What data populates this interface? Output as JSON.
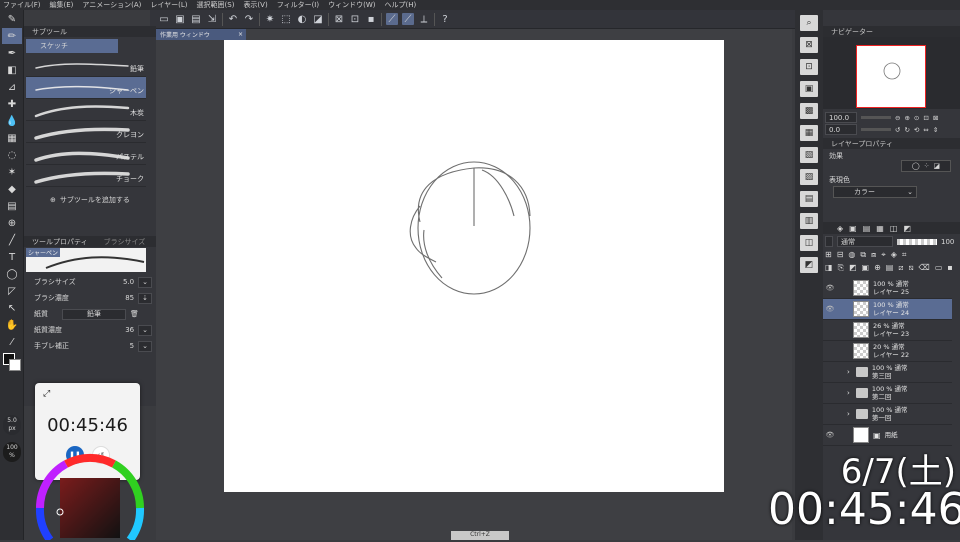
{
  "menu": [
    "ファイル(F)",
    "編集(E)",
    "アニメーション(A)",
    "レイヤー(L)",
    "選択範囲(S)",
    "表示(V)",
    "フィルター(I)",
    "ウィンドウ(W)",
    "ヘルプ(H)"
  ],
  "canvas_tab": {
    "label": "作業用 ウィンドウ"
  },
  "sub_tool": {
    "title": "サブツール",
    "active_group": "スケッチ",
    "brushes": [
      {
        "label": "鉛筆",
        "selected": false
      },
      {
        "label": "シャーペン",
        "selected": true
      },
      {
        "label": "木炭",
        "selected": false
      },
      {
        "label": "クレヨン",
        "selected": false
      },
      {
        "label": "パステル",
        "selected": false
      },
      {
        "label": "チョーク",
        "selected": false
      }
    ],
    "add_label": "サブツールを追加する"
  },
  "tool_property": {
    "title": "ツールプロパティ",
    "tab2": "ブラシサイズ",
    "brush_name": "シャーペン",
    "brush_size_label": "ブラシサイズ",
    "brush_size_value": "5.0",
    "brush_density_label": "ブラシ濃度",
    "brush_density_value": "85",
    "paper_label": "紙質",
    "paper_value": "鉛筆",
    "paper_density_label": "紙質濃度",
    "paper_density_value": "36",
    "stabilizer_label": "手ブレ補正",
    "stabilizer_value": "5"
  },
  "size_indicator": {
    "size": "5.0",
    "unit": "px",
    "opacity": "100",
    "opacity_unit": "%"
  },
  "timer": {
    "time": "00:45:46"
  },
  "navigator": {
    "title": "ナビゲーター",
    "zoom": "100.0",
    "rotation": "0.0"
  },
  "layer_property": {
    "title": "レイヤープロパティ",
    "effect_label": "効果",
    "color_label": "表現色",
    "color_value": "カラー"
  },
  "layer_panel": {
    "blend_mode": "通常",
    "opacity": "100"
  },
  "layers": [
    {
      "line1": "100 % 通常",
      "line2": "レイヤー 25",
      "type": "raster",
      "selected": false,
      "visible": true
    },
    {
      "line1": "100 % 通常",
      "line2": "レイヤー 24",
      "type": "raster",
      "selected": true,
      "visible": true
    },
    {
      "line1": "26 % 通常",
      "line2": "レイヤー 23",
      "type": "raster",
      "selected": false,
      "visible": false
    },
    {
      "line1": "20 % 通常",
      "line2": "レイヤー 22",
      "type": "raster",
      "selected": false,
      "visible": false
    },
    {
      "line1": "100 % 通常",
      "line2": "第三回",
      "type": "folder",
      "selected": false,
      "visible": false
    },
    {
      "line1": "100 % 通常",
      "line2": "第二回",
      "type": "folder",
      "selected": false,
      "visible": false
    },
    {
      "line1": "100 % 通常",
      "line2": "第一回",
      "type": "folder",
      "selected": false,
      "visible": false
    },
    {
      "line1": "",
      "line2": "用紙",
      "type": "paper",
      "selected": false,
      "visible": true
    }
  ],
  "overlay": {
    "date": "6/7(土)",
    "time": "00:45:46"
  },
  "bottom_tab": {
    "label": "Ctrl+Z"
  },
  "colors": {
    "accent": "#5a6c93",
    "timer_btn": "#1a66c2"
  }
}
